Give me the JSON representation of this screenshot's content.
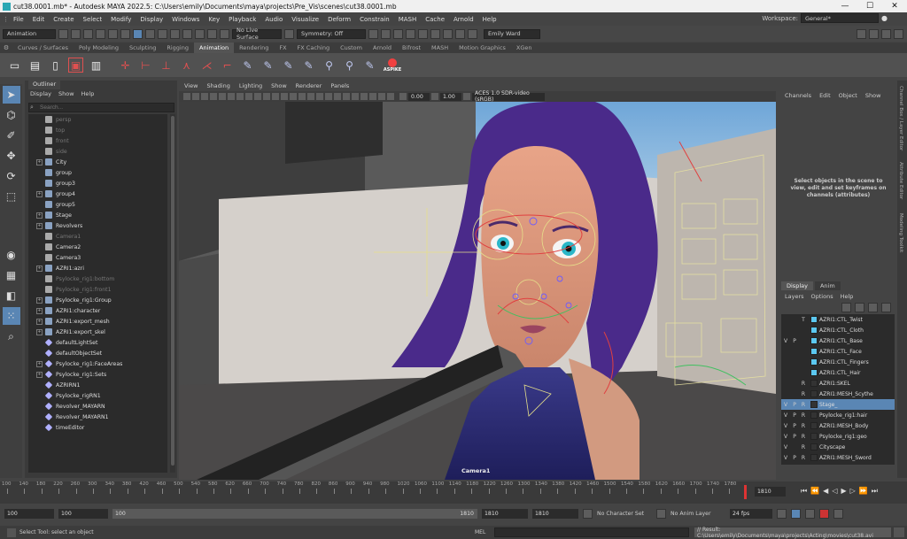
{
  "titlebar": {
    "title": "cut38.0001.mb* - Autodesk MAYA 2022.5: C:\\Users\\emily\\Documents\\maya\\projects\\Pre_Vis\\scenes\\cut38.0001.mb",
    "minimize": "—",
    "maximize": "☐",
    "close": "✕"
  },
  "menubar": {
    "items": [
      "File",
      "Edit",
      "Create",
      "Select",
      "Modify",
      "Display",
      "Windows",
      "Key",
      "Playback",
      "Audio",
      "Visualize",
      "Deform",
      "Constrain",
      "MASH",
      "Cache",
      "Arnold",
      "Help"
    ],
    "workspace_label": "Workspace:",
    "workspace_value": "General*"
  },
  "statusline": {
    "menuset": "Animation",
    "live_surface": "No Live Surface",
    "symmetry": "Symmetry: Off",
    "user": "Emily Ward"
  },
  "shelf": {
    "tabs": [
      "Curves / Surfaces",
      "Poly Modeling",
      "Sculpting",
      "Rigging",
      "Animation",
      "Rendering",
      "FX",
      "FX Caching",
      "Custom",
      "Arnold",
      "Bifrost",
      "MASH",
      "Motion Graphics",
      "XGen"
    ],
    "active": "Animation",
    "plugin_label": "ASPIKE"
  },
  "outliner": {
    "tab": "Outliner",
    "menu": [
      "Display",
      "Show",
      "Help"
    ],
    "search_placeholder": "Search...",
    "items": [
      {
        "label": "persp",
        "dim": true,
        "exp": false,
        "icon": "cam"
      },
      {
        "label": "top",
        "dim": true,
        "exp": false,
        "icon": "cam"
      },
      {
        "label": "front",
        "dim": true,
        "exp": false,
        "icon": "cam"
      },
      {
        "label": "side",
        "dim": true,
        "exp": false,
        "icon": "cam"
      },
      {
        "label": "City",
        "dim": false,
        "exp": true,
        "icon": "grp"
      },
      {
        "label": "group",
        "dim": false,
        "exp": false,
        "icon": "grp"
      },
      {
        "label": "group3",
        "dim": false,
        "exp": false,
        "icon": "grp"
      },
      {
        "label": "group4",
        "dim": false,
        "exp": true,
        "icon": "grp"
      },
      {
        "label": "group5",
        "dim": false,
        "exp": false,
        "icon": "grp"
      },
      {
        "label": "Stage",
        "dim": false,
        "exp": true,
        "icon": "grp"
      },
      {
        "label": "Revolvers",
        "dim": false,
        "exp": true,
        "icon": "grp"
      },
      {
        "label": "Camera1",
        "dim": true,
        "exp": false,
        "icon": "cam"
      },
      {
        "label": "Camera2",
        "dim": false,
        "exp": false,
        "icon": "cam"
      },
      {
        "label": "Camera3",
        "dim": false,
        "exp": false,
        "icon": "cam"
      },
      {
        "label": "AZRI1:azri",
        "dim": false,
        "exp": true,
        "icon": "grp"
      },
      {
        "label": "Psylocke_rig1:bottom",
        "dim": true,
        "exp": false,
        "icon": "cam"
      },
      {
        "label": "Psylocke_rig1:front1",
        "dim": true,
        "exp": false,
        "icon": "cam"
      },
      {
        "label": "Psylocke_rig1:Group",
        "dim": false,
        "exp": true,
        "icon": "grp"
      },
      {
        "label": "AZRI1:character",
        "dim": false,
        "exp": true,
        "icon": "grp"
      },
      {
        "label": "AZRI1:export_mesh",
        "dim": false,
        "exp": true,
        "icon": "grp"
      },
      {
        "label": "AZRI1:export_skel",
        "dim": false,
        "exp": true,
        "icon": "grp"
      },
      {
        "label": "defaultLightSet",
        "dim": false,
        "exp": false,
        "icon": "set"
      },
      {
        "label": "defaultObjectSet",
        "dim": false,
        "exp": false,
        "icon": "set"
      },
      {
        "label": "Psylocke_rig1:FaceAreas",
        "dim": false,
        "exp": true,
        "icon": "set"
      },
      {
        "label": "Psylocke_rig1:Sets",
        "dim": false,
        "exp": true,
        "icon": "set"
      },
      {
        "label": "AZRIRN1",
        "dim": false,
        "exp": false,
        "icon": "set"
      },
      {
        "label": "Psylocke_rigRN1",
        "dim": false,
        "exp": false,
        "icon": "set"
      },
      {
        "label": "Revolver_MAYARN",
        "dim": false,
        "exp": false,
        "icon": "set"
      },
      {
        "label": "Revolver_MAYARN1",
        "dim": false,
        "exp": false,
        "icon": "set"
      },
      {
        "label": "timeEditor",
        "dim": false,
        "exp": false,
        "icon": "set"
      }
    ]
  },
  "viewport": {
    "menu": [
      "View",
      "Shading",
      "Lighting",
      "Show",
      "Renderer",
      "Panels"
    ],
    "exposure": "0.00",
    "gamma": "1.00",
    "colorspace": "ACES 1.0 SDR-video (sRGB)",
    "camera": "Camera1"
  },
  "channelbox": {
    "menu": [
      "Channels",
      "Edit",
      "Object",
      "Show"
    ],
    "message": "Select objects in the scene to view, edit and set keyframes on channels (attributes)"
  },
  "sidetabs": [
    "Channel Box / Layer Editor",
    "Attribute Editor",
    "Modeling Toolkit"
  ],
  "layers": {
    "tabs": [
      "Display",
      "Anim"
    ],
    "active": "Display",
    "menu": [
      "Layers",
      "Options",
      "Help"
    ],
    "rows": [
      {
        "v": "",
        "p": "",
        "r": "T",
        "name": "AZRI1:CTL_Twist",
        "swatch": "b",
        "sel": false
      },
      {
        "v": "",
        "p": "",
        "r": "",
        "name": "AZRI1:CTL_Cloth",
        "swatch": "b",
        "sel": false
      },
      {
        "v": "V",
        "p": "P",
        "r": "",
        "name": "AZRI1:CTL_Base",
        "swatch": "b",
        "sel": false
      },
      {
        "v": "",
        "p": "",
        "r": "",
        "name": "AZRI1:CTL_Face",
        "swatch": "b",
        "sel": false
      },
      {
        "v": "",
        "p": "",
        "r": "",
        "name": "AZRI1:CTL_Fingers",
        "swatch": "b",
        "sel": false
      },
      {
        "v": "",
        "p": "",
        "r": "",
        "name": "AZRI1:CTL_Hair",
        "swatch": "b",
        "sel": false
      },
      {
        "v": "",
        "p": "",
        "r": "R",
        "name": "AZRI1:SKEL",
        "swatch": "e",
        "sel": false
      },
      {
        "v": "",
        "p": "",
        "r": "R",
        "name": "AZRI1:MESH_Scythe",
        "swatch": "e",
        "sel": false
      },
      {
        "v": "V",
        "p": "P",
        "r": "R",
        "name": "Stage_",
        "swatch": "e",
        "sel": true
      },
      {
        "v": "V",
        "p": "P",
        "r": "R",
        "name": "Psylocke_rig1:hair",
        "swatch": "e",
        "sel": false
      },
      {
        "v": "V",
        "p": "P",
        "r": "R",
        "name": "AZRI1:MESH_Body",
        "swatch": "e",
        "sel": false
      },
      {
        "v": "V",
        "p": "P",
        "r": "R",
        "name": "Psylocke_rig1:geo",
        "swatch": "e",
        "sel": false
      },
      {
        "v": "V",
        "p": "",
        "r": "R",
        "name": "Cityscape",
        "swatch": "e",
        "sel": false
      },
      {
        "v": "V",
        "p": "P",
        "r": "R",
        "name": "AZRI1:MESH_Sword",
        "swatch": "e",
        "sel": false
      }
    ]
  },
  "timeline": {
    "start": 100,
    "end": 1810,
    "current_frame": "1810",
    "ticks": [
      100,
      140,
      180,
      220,
      260,
      300,
      340,
      380,
      420,
      460,
      500,
      540,
      580,
      620,
      660,
      700,
      740,
      780,
      820,
      860,
      900,
      940,
      980,
      1020,
      1060,
      1100,
      1140,
      1180,
      1220,
      1260,
      1300,
      1340,
      1380,
      1420,
      1460,
      1500,
      1540,
      1580,
      1620,
      1660,
      1700,
      1740,
      1780
    ]
  },
  "range": {
    "start": "100",
    "anim_start": "100",
    "range_start": "100",
    "range_end": "1810",
    "end": "1810",
    "anim_end": "1810",
    "character": "No Character Set",
    "anim_layer": "No Anim Layer",
    "fps": "24 fps"
  },
  "cmdline": {
    "help": "Select Tool: select an object",
    "lang": "MEL",
    "result": "// Result: C:\\Users\\emily\\Documents\\maya\\projects\\Acting\\movies\\cut38.avi"
  }
}
